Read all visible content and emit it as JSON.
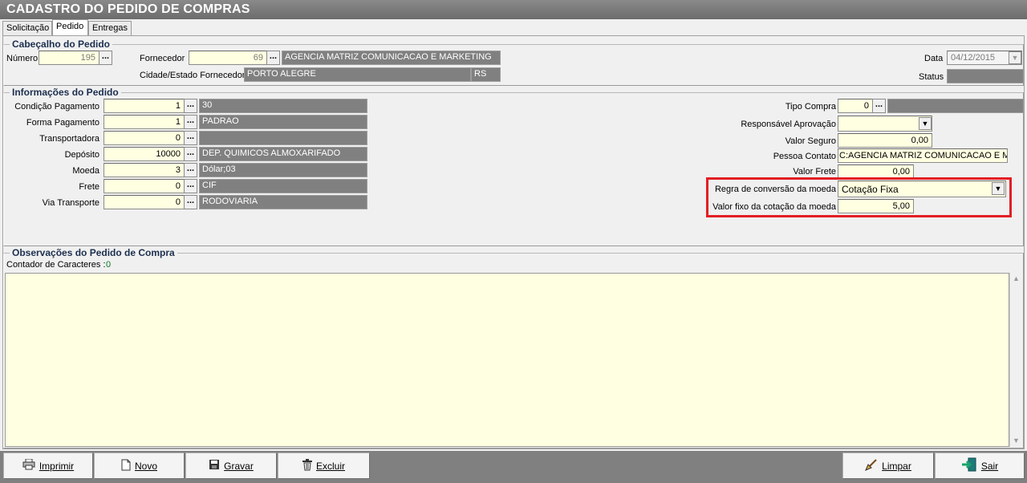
{
  "window": {
    "title": "CADASTRO DO PEDIDO DE COMPRAS"
  },
  "tabs": [
    {
      "label": "Solicitação"
    },
    {
      "label": "Pedido"
    },
    {
      "label": "Entregas"
    }
  ],
  "header": {
    "group_title": "Cabeçalho do Pedido",
    "numero_label": "Número",
    "numero_value": "195",
    "fornecedor_label": "Fornecedor",
    "fornecedor_code": "69",
    "fornecedor_name": "AGENCIA MATRIZ COMUNICACAO E MARKETING",
    "cidade_label": "Cidade/Estado Fornecedor",
    "cidade_value": "PORTO ALEGRE",
    "estado_value": "RS",
    "data_label": "Data",
    "data_value": "04/12/2015",
    "status_label": "Status",
    "status_value": ""
  },
  "info": {
    "group_title": "Informações do Pedido",
    "left_fields": [
      {
        "label": "Condição Pagamento",
        "code": "1",
        "desc": "30"
      },
      {
        "label": "Forma Pagamento",
        "code": "1",
        "desc": "PADRAO"
      },
      {
        "label": "Transportadora",
        "code": "0",
        "desc": ""
      },
      {
        "label": "Depósito",
        "code": "10000",
        "desc": "DEP. QUIMICOS ALMOXARIFADO"
      },
      {
        "label": "Moeda",
        "code": "3",
        "desc": "Dólar;03"
      },
      {
        "label": "Frete",
        "code": "0",
        "desc": "CIF"
      },
      {
        "label": "Via Transporte",
        "code": "0",
        "desc": "RODOVIARIA"
      }
    ],
    "tipo_compra_label": "Tipo Compra",
    "tipo_compra_code": "0",
    "tipo_compra_desc": "",
    "resp_aprov_label": "Responsável Aprovação",
    "resp_aprov_value": "",
    "valor_seguro_label": "Valor Seguro",
    "valor_seguro_value": "0,00",
    "pessoa_contato_label": "Pessoa Contato",
    "pessoa_contato_value": "C:AGENCIA MATRIZ COMUNICACAO E MARKETING",
    "valor_frete_label": "Valor Frete",
    "valor_frete_value": "0,00",
    "regra_conv_label": "Regra de conversão da moeda",
    "regra_conv_value": "Cotação Fixa",
    "valor_fixo_label": "Valor fixo da cotação da moeda",
    "valor_fixo_value": "5,00"
  },
  "obs": {
    "group_title": "Observações do Pedido de Compra",
    "counter_label": "Contador de Caracteres :",
    "counter_value": "0",
    "text": ""
  },
  "footer": {
    "imprimir": "Imprimir",
    "novo": "Novo",
    "gravar": "Gravar",
    "excluir": "Excluir",
    "limpar": "Limpar",
    "sair": "Sair"
  },
  "colors": {
    "highlight": "#e31e24",
    "input_bg": "#ffffe1",
    "readonly_bg": "#808080"
  }
}
